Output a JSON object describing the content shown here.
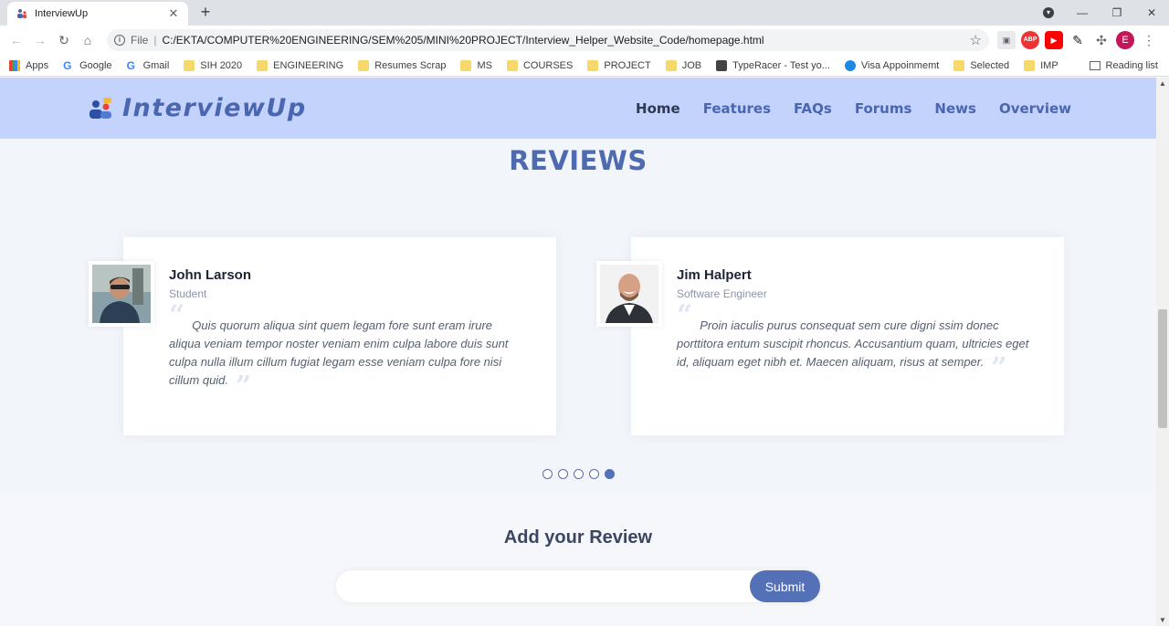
{
  "browser": {
    "tab_title": "InterviewUp",
    "new_tab_symbol": "+",
    "close_symbol": "✕",
    "file_label": "File",
    "url": "C:/EKTA/COMPUTER%20ENGINEERING/SEM%205/MINI%20PROJECT/Interview_Helper_Website_Code/homepage.html",
    "profile_initial": "E",
    "bookmarks": [
      {
        "label": "Apps",
        "icon": "apps-icon"
      },
      {
        "label": "Google",
        "icon": "google-icon"
      },
      {
        "label": "Gmail",
        "icon": "google-icon"
      },
      {
        "label": "SIH 2020",
        "icon": "folder-icon"
      },
      {
        "label": "ENGINEERING",
        "icon": "folder-icon"
      },
      {
        "label": "Resumes Scrap",
        "icon": "folder-icon"
      },
      {
        "label": "MS",
        "icon": "folder-icon"
      },
      {
        "label": "COURSES",
        "icon": "folder-icon"
      },
      {
        "label": "PROJECT",
        "icon": "folder-icon"
      },
      {
        "label": "JOB",
        "icon": "folder-icon"
      },
      {
        "label": "TypeRacer - Test yo...",
        "icon": "typeracer-icon"
      },
      {
        "label": "Visa Appoinmemt",
        "icon": "cloud-icon"
      },
      {
        "label": "Selected",
        "icon": "folder-icon"
      },
      {
        "label": "IMP",
        "icon": "folder-icon"
      }
    ],
    "reading_list": "Reading list"
  },
  "site": {
    "logo_text": "InterviewUp",
    "nav": [
      "Home",
      "Features",
      "FAQs",
      "Forums",
      "News",
      "Overview"
    ],
    "active_nav": "Home"
  },
  "reviews": {
    "heading": "REVIEWS",
    "items": [
      {
        "name": "John Larson",
        "role": "Student",
        "text": "Quis quorum aliqua sint quem legam fore sunt eram irure aliqua veniam tempor noster veniam enim culpa labore duis sunt culpa nulla illum cillum fugiat legam esse veniam culpa fore nisi cillum quid."
      },
      {
        "name": "Jim Halpert",
        "role": "Software Engineer",
        "text": "Proin iaculis purus consequat sem cure digni ssim donec porttitora entum suscipit rhoncus. Accusantium quam, ultricies eget id, aliquam eget nibh et. Maecen aliquam, risus at semper."
      }
    ],
    "pagination": {
      "total": 5,
      "active_index": 4
    }
  },
  "add_review": {
    "heading": "Add your Review",
    "placeholder": "",
    "value": "",
    "submit_label": "Submit"
  },
  "colors": {
    "navbar_bg": "#c3d3fb",
    "brand": "#4b66b1",
    "heading": "#4e6bb0",
    "button": "#5470b7"
  }
}
